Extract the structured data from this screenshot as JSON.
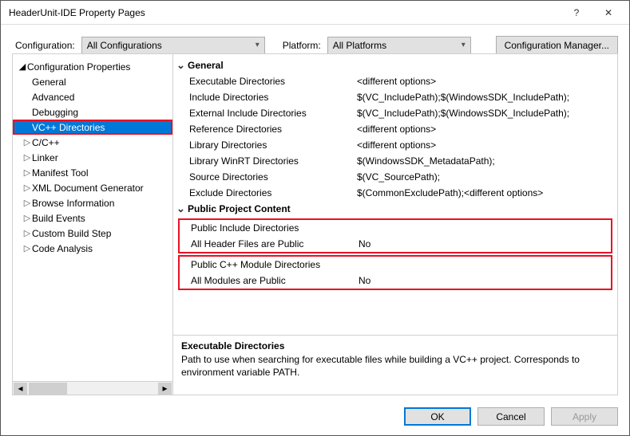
{
  "window": {
    "title": "HeaderUnit-IDE Property Pages"
  },
  "top": {
    "config_label": "Configuration:",
    "config_value": "All Configurations",
    "platform_label": "Platform:",
    "platform_value": "All Platforms",
    "manager_label": "Configuration Manager..."
  },
  "tree": {
    "root": "Configuration Properties",
    "items": [
      {
        "label": "General",
        "expander": ""
      },
      {
        "label": "Advanced",
        "expander": ""
      },
      {
        "label": "Debugging",
        "expander": ""
      },
      {
        "label": "VC++ Directories",
        "expander": "",
        "selected": true,
        "red": true
      },
      {
        "label": "C/C++",
        "expander": "▷"
      },
      {
        "label": "Linker",
        "expander": "▷"
      },
      {
        "label": "Manifest Tool",
        "expander": "▷"
      },
      {
        "label": "XML Document Generator",
        "expander": "▷"
      },
      {
        "label": "Browse Information",
        "expander": "▷"
      },
      {
        "label": "Build Events",
        "expander": "▷"
      },
      {
        "label": "Custom Build Step",
        "expander": "▷"
      },
      {
        "label": "Code Analysis",
        "expander": "▷"
      }
    ]
  },
  "grid": {
    "groups": [
      {
        "name": "General",
        "rows": [
          {
            "name": "Executable Directories",
            "value": "<different options>"
          },
          {
            "name": "Include Directories",
            "value": "$(VC_IncludePath);$(WindowsSDK_IncludePath);"
          },
          {
            "name": "External Include Directories",
            "value": "$(VC_IncludePath);$(WindowsSDK_IncludePath);"
          },
          {
            "name": "Reference Directories",
            "value": "<different options>"
          },
          {
            "name": "Library Directories",
            "value": "<different options>"
          },
          {
            "name": "Library WinRT Directories",
            "value": "$(WindowsSDK_MetadataPath);"
          },
          {
            "name": "Source Directories",
            "value": "$(VC_SourcePath);"
          },
          {
            "name": "Exclude Directories",
            "value": "$(CommonExcludePath);<different options>"
          }
        ]
      },
      {
        "name": "Public Project Content",
        "rows": [
          {
            "name": "Public Include Directories",
            "value": "",
            "hl": true
          },
          {
            "name": "All Header Files are Public",
            "value": "No",
            "hl": true
          },
          {
            "name": "Public C++ Module Directories",
            "value": "",
            "hl": true
          },
          {
            "name": "All Modules are Public",
            "value": "No",
            "hl": true
          }
        ]
      }
    ]
  },
  "desc": {
    "title": "Executable Directories",
    "text": "Path to use when searching for executable files while building a VC++ project.  Corresponds to environment variable PATH."
  },
  "buttons": {
    "ok": "OK",
    "cancel": "Cancel",
    "apply": "Apply"
  }
}
